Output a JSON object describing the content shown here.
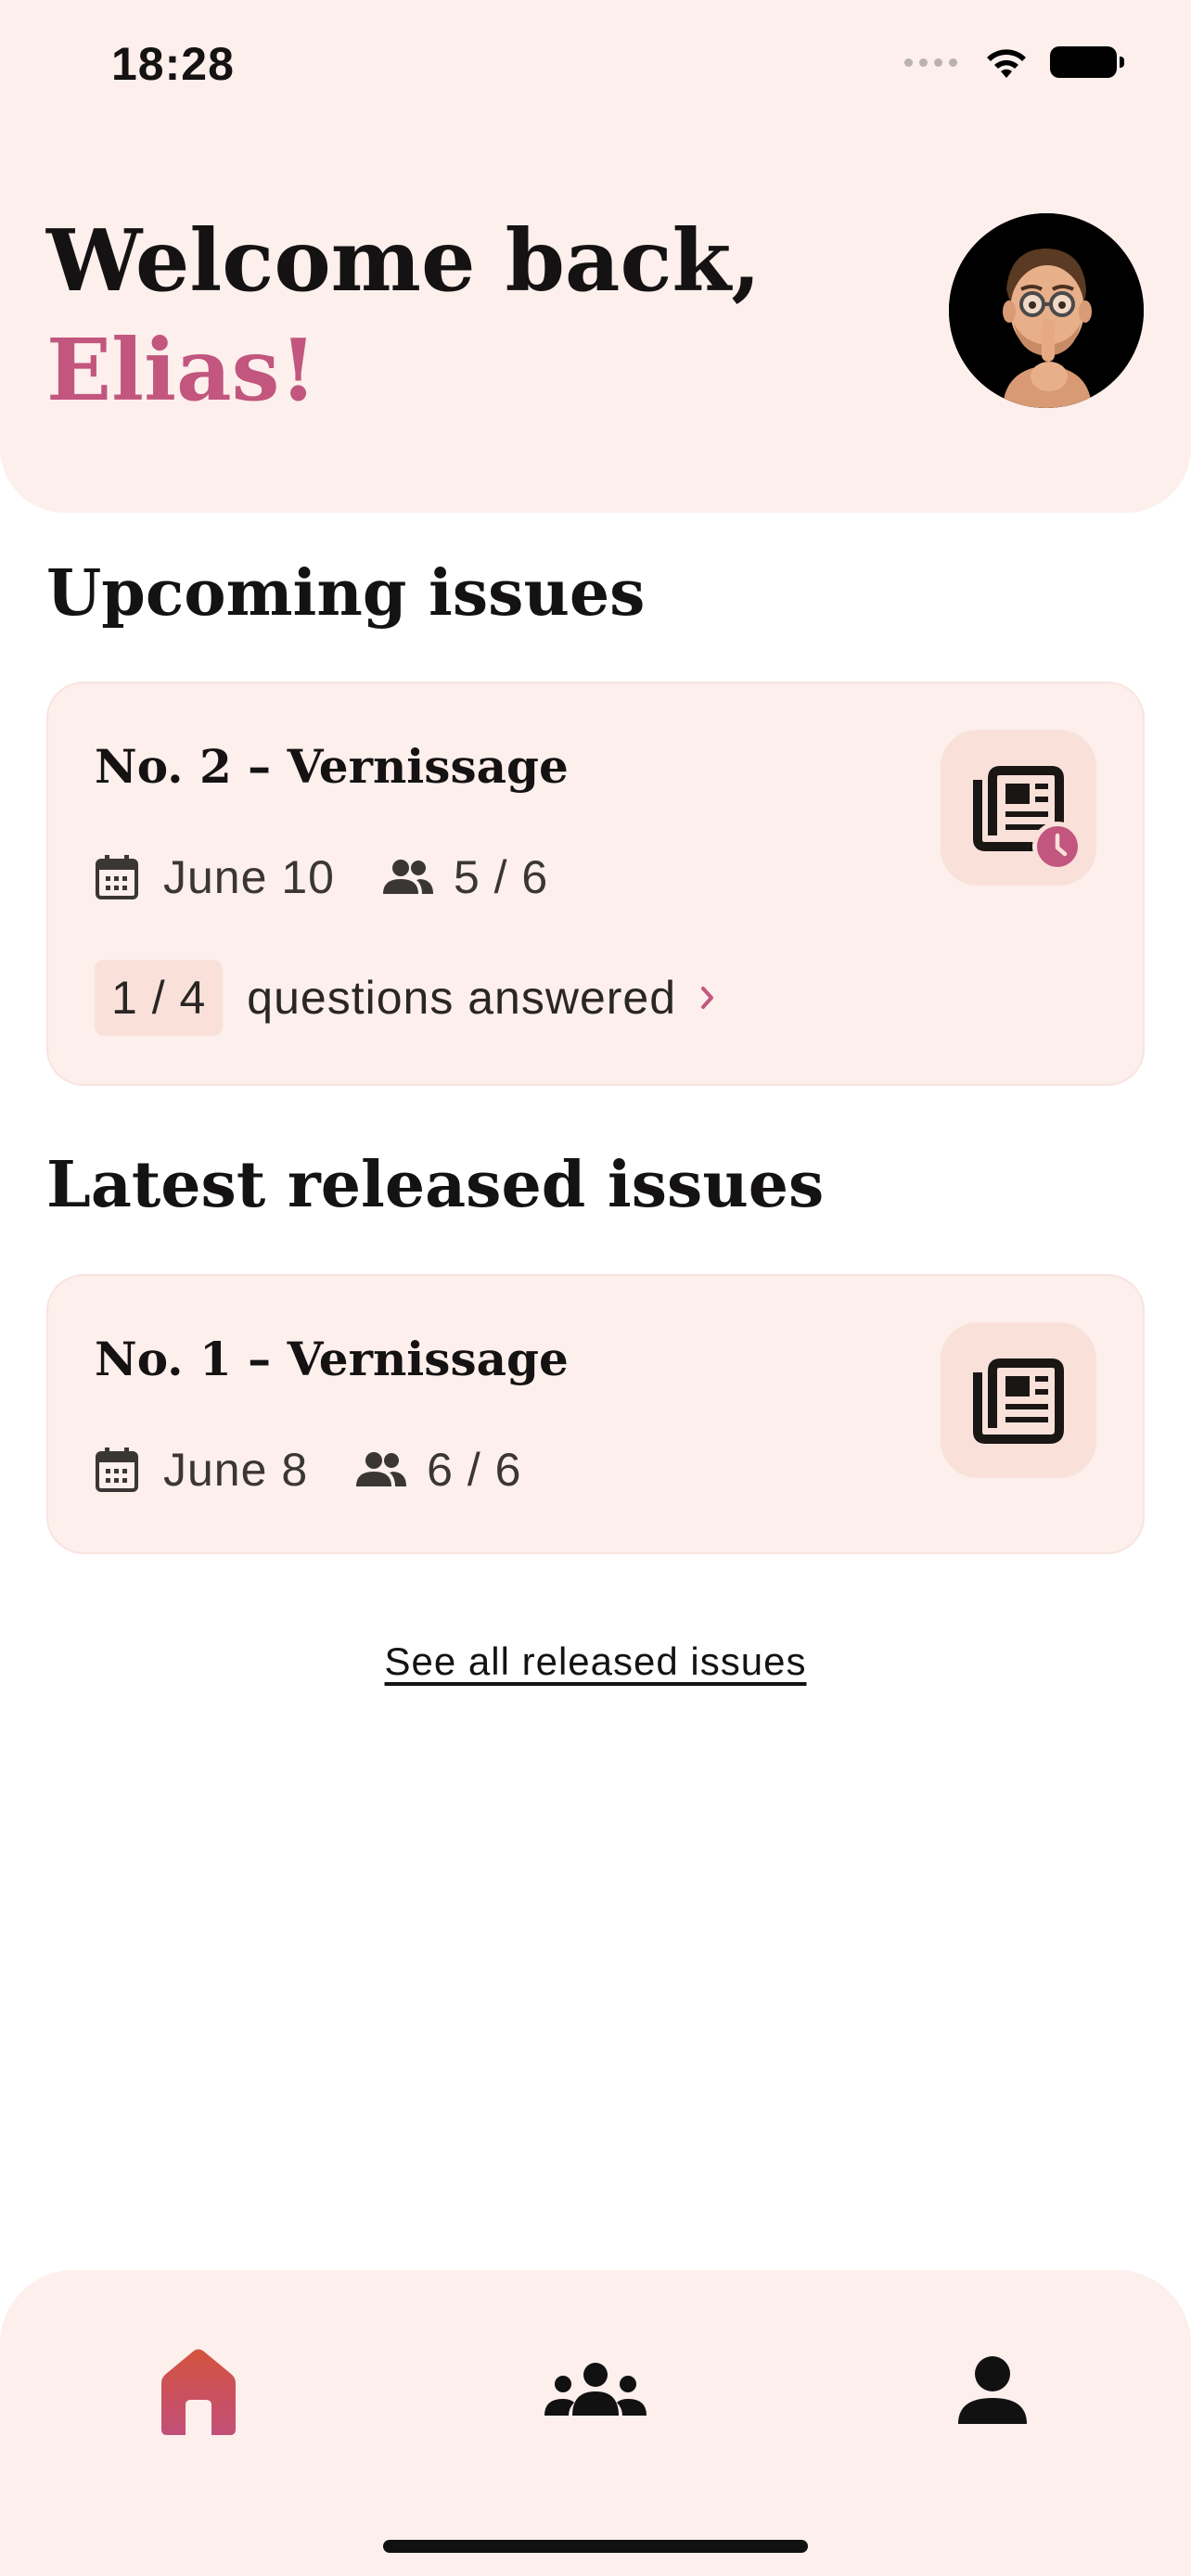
{
  "status_bar": {
    "time": "18:28"
  },
  "header": {
    "greeting": "Welcome back,",
    "name": "Elias!"
  },
  "upcoming": {
    "section_title": "Upcoming issues",
    "issue": {
      "title": "No. 2 – Vernissage",
      "date": "June 10",
      "members": "5 / 6",
      "answered_count": "1 / 4",
      "answered_label": "questions answered"
    }
  },
  "released": {
    "section_title": "Latest released issues",
    "issue": {
      "title": "No. 1 – Vernissage",
      "date": "June 8",
      "members": "6 / 6"
    }
  },
  "see_all_link": "See all released issues",
  "nav": {
    "items": [
      {
        "icon": "home-icon",
        "active": true
      },
      {
        "icon": "group-icon",
        "active": false
      },
      {
        "icon": "profile-icon",
        "active": false
      }
    ]
  },
  "colors": {
    "accent": "#c2567e",
    "card_bg": "#fcefec",
    "icon_bg": "#f9e1da",
    "home_gradient_top": "#d4533e",
    "home_gradient_bottom": "#c24f79"
  }
}
